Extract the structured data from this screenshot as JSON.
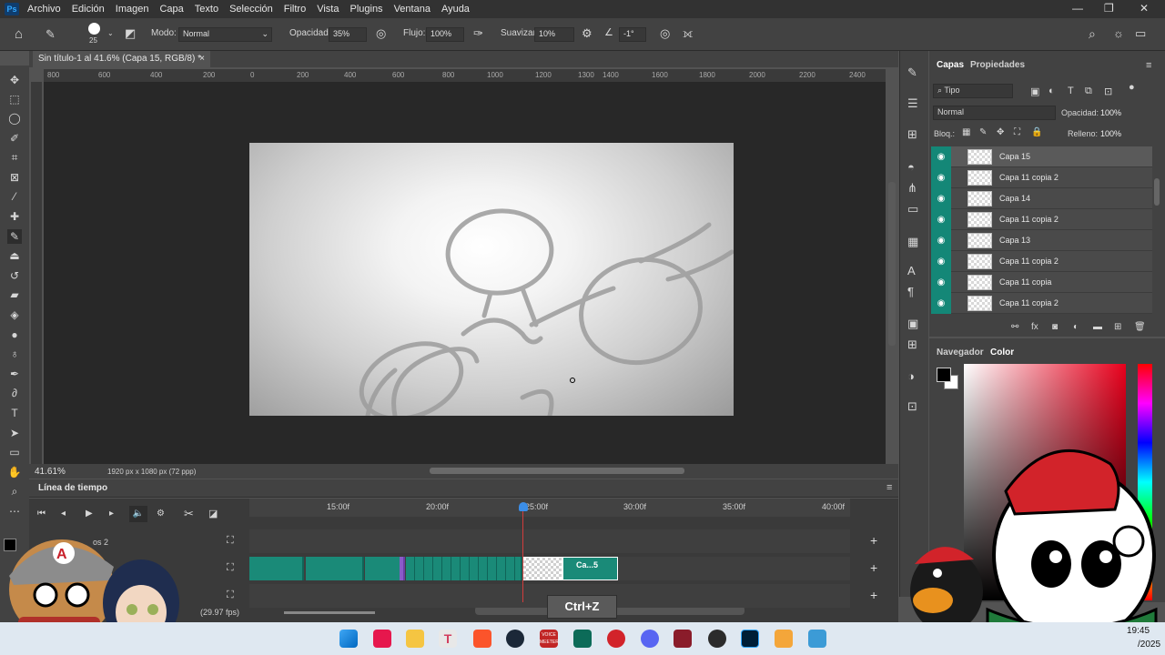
{
  "menubar": {
    "logo": "Ps",
    "items": [
      "Archivo",
      "Edición",
      "Imagen",
      "Capa",
      "Texto",
      "Selección",
      "Filtro",
      "Vista",
      "Plugins",
      "Ventana",
      "Ayuda"
    ]
  },
  "options": {
    "brush_size": "25",
    "mode_label": "Modo:",
    "mode_value": "Normal",
    "opacity_label": "Opacidad:",
    "opacity_value": "35%",
    "flow_label": "Flujo:",
    "flow_value": "100%",
    "smoothing_label": "Suavizar:",
    "smoothing_value": "10%",
    "angle_value": "-1°"
  },
  "document": {
    "tab_title": "Sin título-1 al 41.6% (Capa 15, RGB/8) *",
    "ruler_ticks": [
      "800",
      "600",
      "400",
      "200",
      "0",
      "200",
      "400",
      "600",
      "800",
      "1000",
      "1200",
      "1300",
      "1400",
      "1600",
      "1800",
      "2000",
      "2200",
      "2400"
    ],
    "zoom": "41.61%",
    "doc_info": "1920 px x 1080 px (72 ppp)"
  },
  "timeline": {
    "title": "Línea de tiempo",
    "ticks": [
      "15:00f",
      "20:00f",
      "25:00f",
      "30:00f",
      "35:00f",
      "40:00f"
    ],
    "track_label": "os 2",
    "fps": "(29.97 fps)",
    "clip_label": "Ca...5",
    "shortcut_overlay": "Ctrl+Z"
  },
  "layers_panel": {
    "tab_layers": "Capas",
    "tab_properties": "Propiedades",
    "filter_value": "Tipo",
    "blend_mode": "Normal",
    "opacity_label": "Opacidad:",
    "opacity_value": "100%",
    "lock_label": "Bloq.:",
    "fill_label": "Relleno:",
    "fill_value": "100%",
    "layers": [
      {
        "name": "Capa 15",
        "selected": true
      },
      {
        "name": "Capa 11 copia 2",
        "selected": false
      },
      {
        "name": "Capa 14",
        "selected": false
      },
      {
        "name": "Capa 11 copia 2",
        "selected": false
      },
      {
        "name": "Capa 13",
        "selected": false
      },
      {
        "name": "Capa 11 copia 2",
        "selected": false
      },
      {
        "name": "Capa 11 copia",
        "selected": false
      },
      {
        "name": "Capa 11 copia 2",
        "selected": false
      }
    ]
  },
  "color_panel": {
    "tab_navigator": "Navegador",
    "tab_color": "Color",
    "foreground": "#000000",
    "background": "#ffffff",
    "hue_color": "#e8001c"
  },
  "taskbar": {
    "time": "19:45",
    "date_partial": "/2025",
    "badge_voicemeeter": "VOICE\nMEETER"
  },
  "colors": {
    "accent_teal": "#1a8a78",
    "panel_bg": "#424242",
    "canvas_bg": "#282828",
    "playhead": "#d23c3c"
  }
}
